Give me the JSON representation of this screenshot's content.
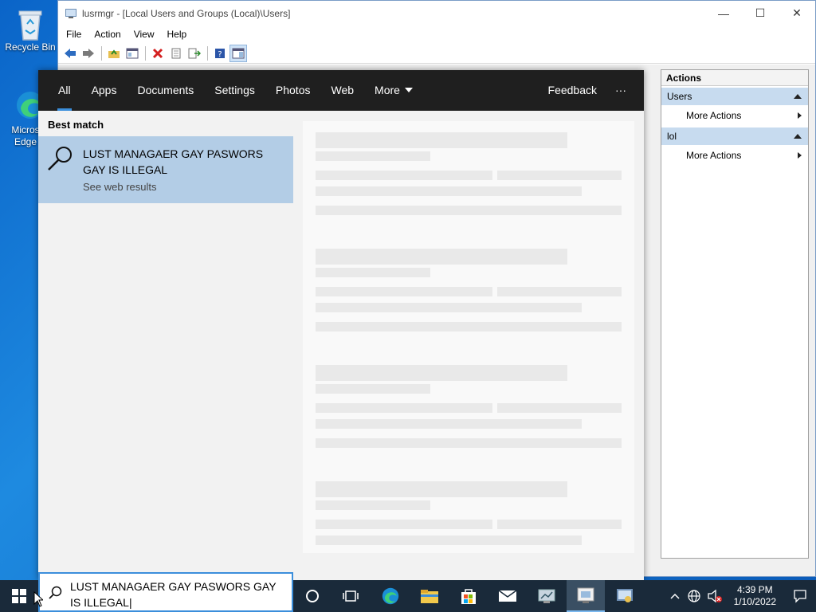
{
  "desktop": {
    "icons": [
      {
        "label": "Recycle Bin"
      },
      {
        "label": "Micros Edge"
      }
    ]
  },
  "window": {
    "title": "lusrmgr - [Local Users and Groups (Local)\\Users]",
    "controls": {
      "minimize": "—",
      "maximize": "☐",
      "close": "✕"
    },
    "menu": [
      "File",
      "Action",
      "View",
      "Help"
    ]
  },
  "actions_pane": {
    "header": "Actions",
    "groups": [
      {
        "label": "Users",
        "item": "More Actions"
      },
      {
        "label": "lol",
        "item": "More Actions"
      }
    ]
  },
  "search": {
    "tabs": [
      "All",
      "Apps",
      "Documents",
      "Settings",
      "Photos",
      "Web",
      "More"
    ],
    "feedback": "Feedback",
    "overflow": "···",
    "best_match_label": "Best match",
    "best_match": {
      "query": "LUST MANAGAER GAY PASWORS GAY IS ILLEGAL",
      "subtitle": "See web results"
    },
    "input_value": "LUST MANAGAER GAY PASWORS GAY IS ILLEGAL"
  },
  "taskbar": {
    "time": "4:39 PM",
    "date": "1/10/2022"
  }
}
